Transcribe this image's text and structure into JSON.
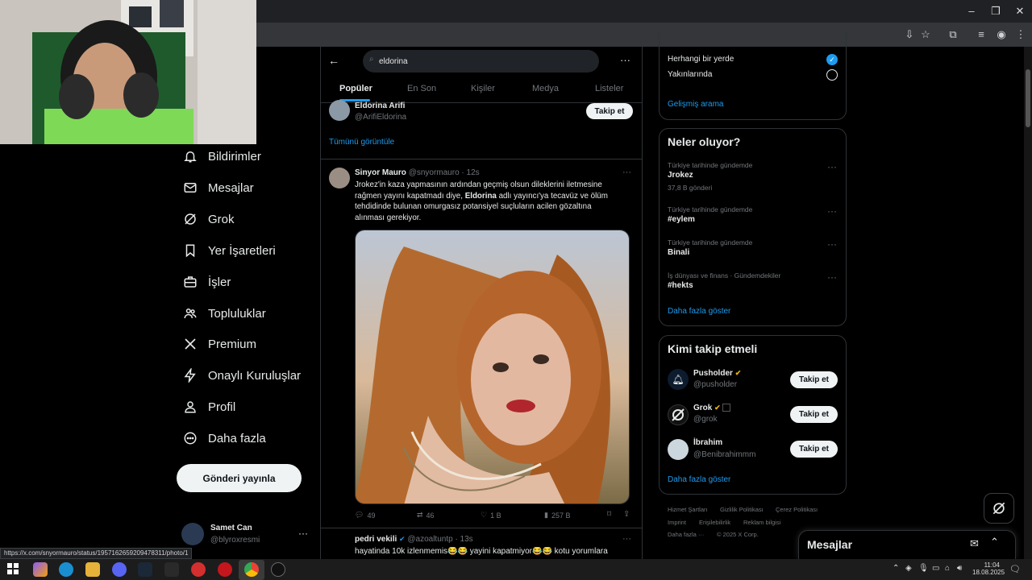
{
  "search": {
    "query": "eldorina"
  },
  "tabs": [
    "Popüler",
    "En Son",
    "Kişiler",
    "Medya",
    "Listeler"
  ],
  "nav": {
    "items": [
      {
        "label": "Bildirimler",
        "icon": "bell-icon"
      },
      {
        "label": "Mesajlar",
        "icon": "mail-icon"
      },
      {
        "label": "Grok",
        "icon": "grok-icon"
      },
      {
        "label": "Yer İşaretleri",
        "icon": "bookmark-icon"
      },
      {
        "label": "İşler",
        "icon": "briefcase-icon"
      },
      {
        "label": "Topluluklar",
        "icon": "people-icon"
      },
      {
        "label": "Premium",
        "icon": "x-logo-icon"
      },
      {
        "label": "Onaylı Kuruluşlar",
        "icon": "lightning-icon"
      },
      {
        "label": "Profil",
        "icon": "person-icon"
      },
      {
        "label": "Daha fazla",
        "icon": "more-circle-icon"
      }
    ],
    "post_button": "Gönderi yayınla",
    "account": {
      "name": "Samet Can",
      "handle": "@blyroxresmi"
    }
  },
  "people_result": {
    "name": "Eldorina Arifi",
    "handle": "@ArifiEldorina",
    "follow": "Takip et",
    "show_all": "Tümünü görüntüle"
  },
  "tweet": {
    "author": "Sinyor Mauro",
    "handle": "@snyormauro",
    "time": "· 12s",
    "text_parts": [
      "Jrokez'in kaza yapmasının ardından geçmiş olsun dileklerini iletmesine rağmen yayını kapatmadı diye, ",
      "Eldorina",
      " adlı yayıncı'ya tecavüz ve ölüm tehdidinde bulunan omurgasız potansiyel suçluların acilen gözaltına alınması gerekiyor."
    ],
    "replies": "49",
    "retweets": "46",
    "likes": "1 B",
    "views": "257 B"
  },
  "tweet2": {
    "author": "pedri vekili",
    "handle": "@azoaltuntp",
    "time": "· 13s",
    "text": "hayatinda 10k izlenmemis😂😂 yayini kapatmiyor😂😂 kotu yorumlara"
  },
  "location_filter": {
    "option1": "Herhangi bir yerde",
    "option2": "Yakınlarında",
    "advanced": "Gelişmiş arama"
  },
  "trends": {
    "title": "Neler oluyor?",
    "items": [
      {
        "context": "Türkiye tarihinde gündemde",
        "name": "Jrokez",
        "count": "37,8 B gönderi"
      },
      {
        "context": "Türkiye tarihinde gündemde",
        "name": "#eylem",
        "count": ""
      },
      {
        "context": "Türkiye tarihinde gündemde",
        "name": "Binali",
        "count": ""
      },
      {
        "context": "İş dünyası ve finans · Gündemdekiler",
        "name": "#hekts",
        "count": ""
      }
    ],
    "show_more": "Daha fazla göster"
  },
  "who_to_follow": {
    "title": "Kimi takip etmeli",
    "items": [
      {
        "name": "Pusholder",
        "handle": "@pusholder",
        "button": "Takip et"
      },
      {
        "name": "Grok",
        "handle": "@grok",
        "button": "Takip et"
      },
      {
        "name": "İbrahim",
        "handle": "@Benibrahimmm",
        "button": "Takip et"
      }
    ],
    "show_more": "Daha fazla göster"
  },
  "footer": {
    "links": [
      "Hizmet Şartları",
      "Gizlilik Politikası",
      "Çerez Politikası",
      "Imprint",
      "Erişilebilirlik",
      "Reklam bilgisi",
      "Daha fazla ···",
      "© 2025 X Corp."
    ]
  },
  "messages_drawer": {
    "title": "Mesajlar"
  },
  "status_url": "https://x.com/snyormauro/status/1957162659209478311/photo/1",
  "taskbar": {
    "time": "11:04",
    "date": "18.08.2025"
  },
  "colors": {
    "accent": "#1d9bf0",
    "bg": "#000000",
    "text": "#e7e9ea",
    "muted": "#71767b",
    "border": "#2f3336"
  }
}
